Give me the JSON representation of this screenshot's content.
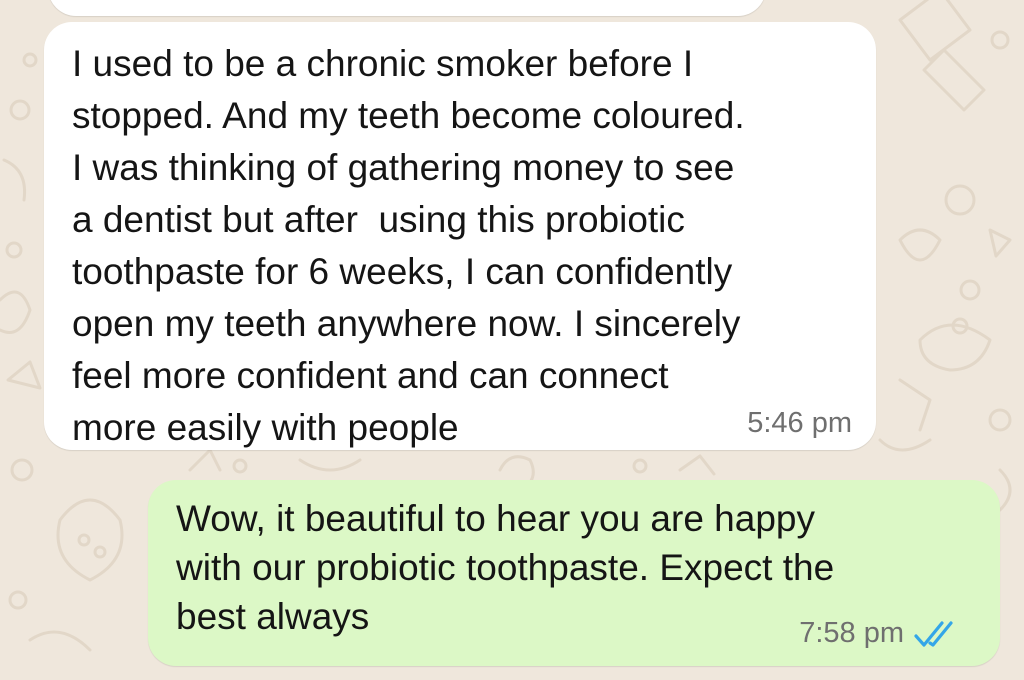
{
  "conversation": {
    "messages": [
      {
        "direction": "incoming",
        "text": "I used to be a chronic smoker before I\nstopped. And my teeth become coloured.\nI was thinking of gathering money to see\na dentist but after  using this probiotic\ntoothpaste for 6 weeks, I can confidently\nopen my teeth anywhere now. I sincerely\nfeel more confident and can connect\nmore easily with people",
        "time": "5:46 pm"
      },
      {
        "direction": "outgoing",
        "text": "Wow, it beautiful to hear you are happy\nwith our probiotic toothpaste. Expect the\nbest always",
        "time": "7:58 pm",
        "status_icon": "double-check-read-icon"
      }
    ]
  },
  "colors": {
    "wallpaper": "#efe7dc",
    "incoming_bubble": "#ffffff",
    "outgoing_bubble": "#dcf8c6",
    "read_ticks": "#34a6e8"
  }
}
